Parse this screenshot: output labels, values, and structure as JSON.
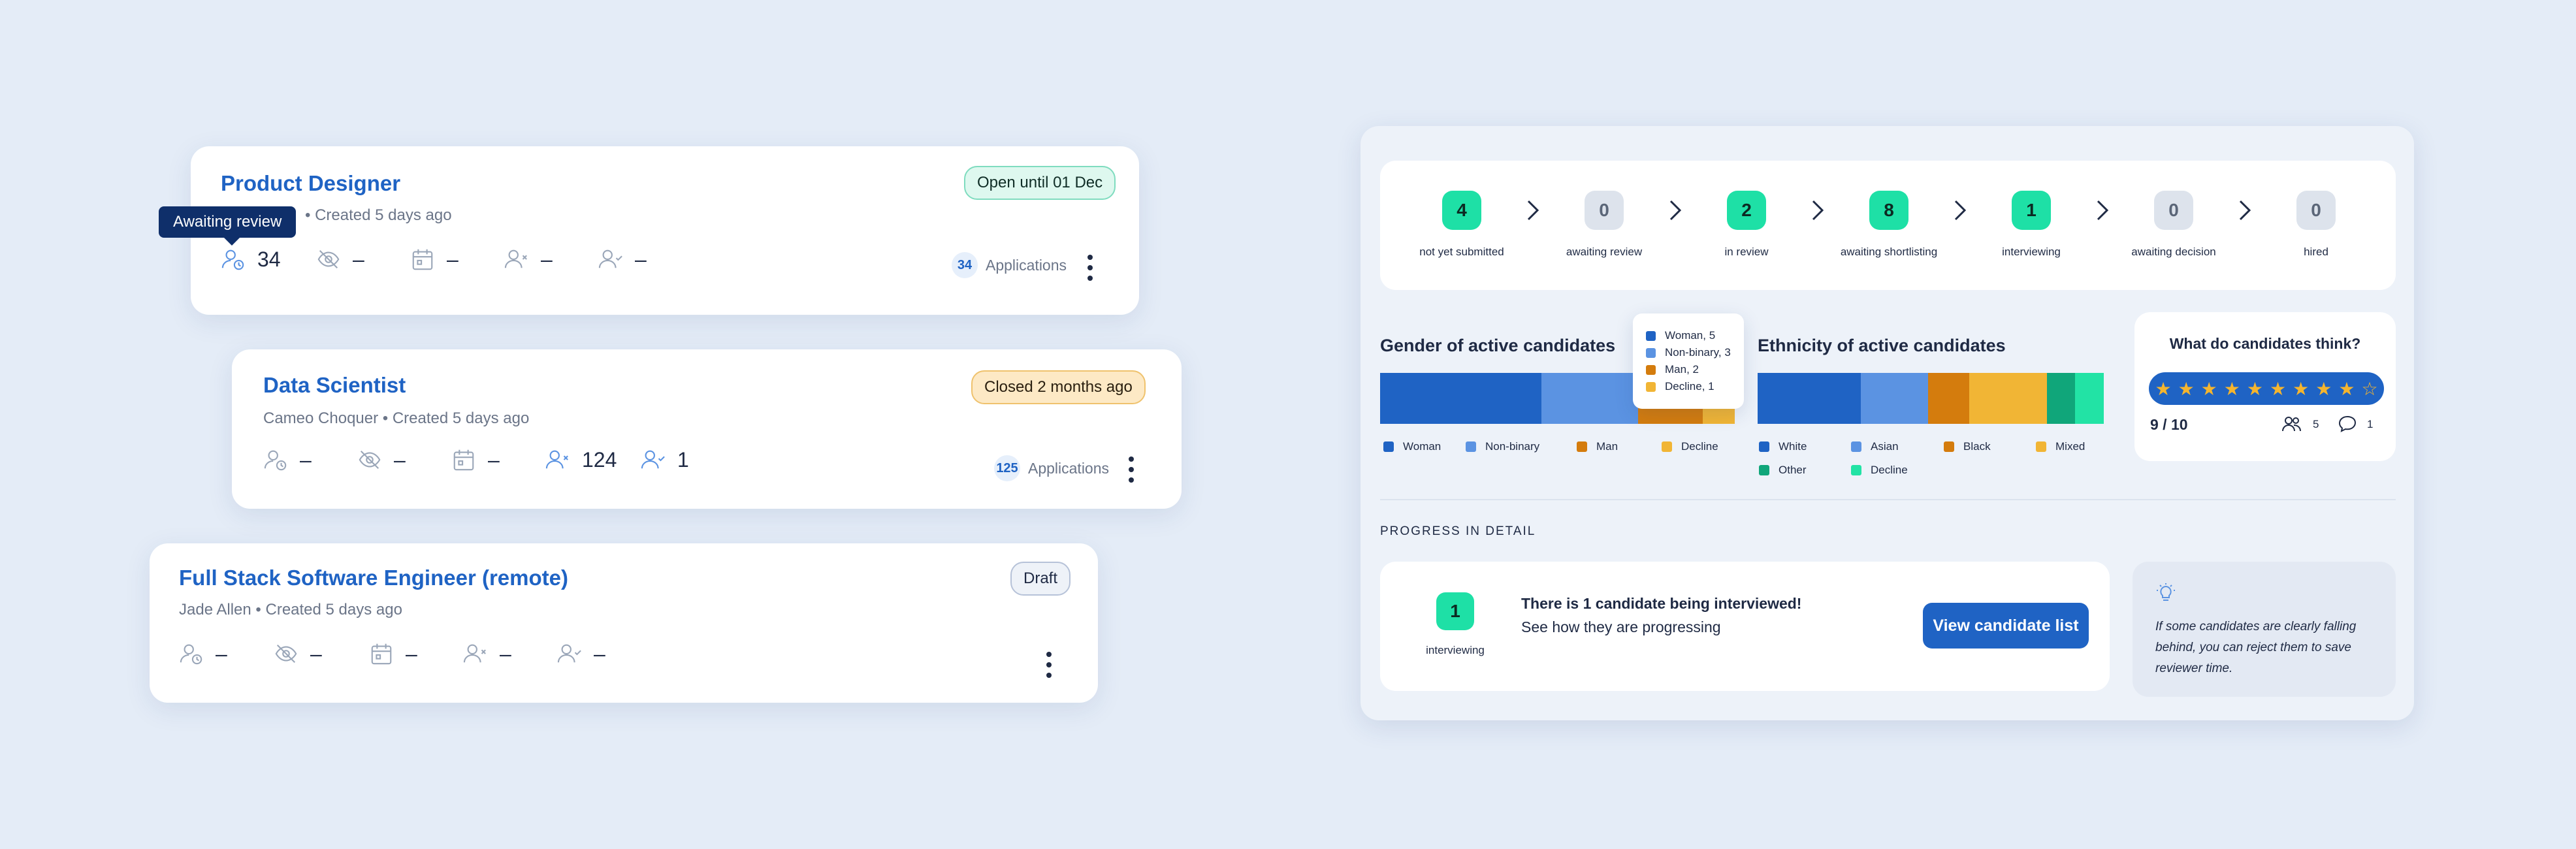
{
  "jobs": [
    {
      "title": "Product Designer",
      "subtitle_partial": "• Created 5 days ago",
      "status": "Open until 01 Dec",
      "tooltip": "Awaiting review",
      "stats": [
        "34",
        "–",
        "–",
        "–",
        "–"
      ],
      "applications_count": "34",
      "applications_label": "Applications"
    },
    {
      "title": "Data Scientist",
      "subtitle": "Cameo Choquer • Created 5 days ago",
      "status": "Closed 2 months ago",
      "stats": [
        "–",
        "–",
        "–",
        "124",
        "1"
      ],
      "applications_count": "125",
      "applications_label": "Applications"
    },
    {
      "title": "Full Stack Software Engineer (remote)",
      "subtitle": "Jade Allen • Created 5 days ago",
      "status": "Draft",
      "stats": [
        "–",
        "–",
        "–",
        "–",
        "–"
      ]
    }
  ],
  "pipeline": [
    {
      "count": "4",
      "label": "not yet submitted",
      "active": true
    },
    {
      "count": "0",
      "label": "awaiting review",
      "active": false
    },
    {
      "count": "2",
      "label": "in review",
      "active": true
    },
    {
      "count": "8",
      "label": "awaiting shortlisting",
      "active": true
    },
    {
      "count": "1",
      "label": "interviewing",
      "active": true
    },
    {
      "count": "0",
      "label": "awaiting decision",
      "active": false
    },
    {
      "count": "0",
      "label": "hired",
      "active": false
    }
  ],
  "gender": {
    "title": "Gender of active candidates",
    "segments": [
      {
        "label": "Woman",
        "value": 5,
        "color": "#1f63c4"
      },
      {
        "label": "Non-binary",
        "value": 3,
        "color": "#5b93e2"
      },
      {
        "label": "Man",
        "value": 2,
        "color": "#d47c0d"
      },
      {
        "label": "Decline",
        "value": 1,
        "color": "#f1b535"
      }
    ],
    "tooltip": [
      "Woman, 5",
      "Non-binary, 3",
      "Man, 2",
      "Decline, 1"
    ]
  },
  "ethnicity": {
    "title": "Ethnicity of active candidates",
    "segments": [
      {
        "label": "White",
        "value": 4,
        "color": "#1f63c4"
      },
      {
        "label": "Asian",
        "value": 2.6,
        "color": "#5b93e2"
      },
      {
        "label": "Black",
        "value": 1.6,
        "color": "#d47c0d"
      },
      {
        "label": "Mixed",
        "value": 3,
        "color": "#f1b535"
      },
      {
        "label": "Other",
        "value": 1.1,
        "color": "#10a67a"
      },
      {
        "label": "Decline",
        "value": 1.1,
        "color": "#22e3a5"
      }
    ]
  },
  "feedback": {
    "title": "What do candidates think?",
    "rating": "9 / 10",
    "stars_filled": 9,
    "stars_total": 10,
    "reviewers": "5",
    "comments": "1"
  },
  "progress": {
    "heading": "PROGRESS IN DETAIL",
    "count": "1",
    "count_label": "interviewing",
    "message_bold": "There is 1 candidate being interviewed!",
    "message": "See how they are progressing",
    "button": "View candidate list",
    "tip": "If some candidates are clearly falling behind, you can reject them to save reviewer time."
  }
}
